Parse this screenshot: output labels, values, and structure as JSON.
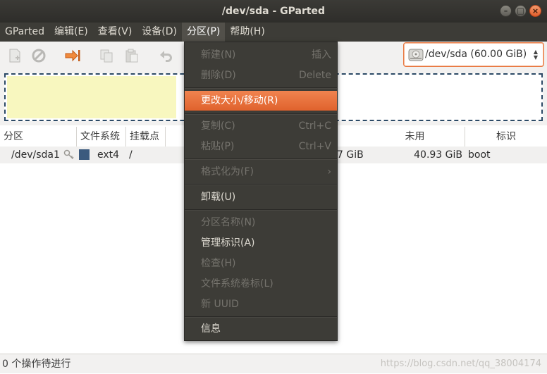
{
  "window": {
    "title": "/dev/sda - GParted"
  },
  "menubar": {
    "items": [
      {
        "label": "GParted"
      },
      {
        "label": "编辑(E)"
      },
      {
        "label": "查看(V)"
      },
      {
        "label": "设备(D)"
      },
      {
        "label": "分区(P)"
      },
      {
        "label": "帮助(H)"
      }
    ]
  },
  "toolbar": {
    "icons": [
      "new-icon",
      "delete-icon",
      "resize-move-icon",
      "copy-icon",
      "paste-icon",
      "undo-icon"
    ]
  },
  "device_selector": {
    "label": "/dev/sda   (60.00 GiB)"
  },
  "table": {
    "headers": [
      "分区",
      "文件系统",
      "挂载点",
      "未用",
      "标识"
    ],
    "row": {
      "partition": "/dev/sda1",
      "filesystem": "ext4",
      "mountpoint": "/",
      "size_partial": "7 GiB",
      "unused": "40.93 GiB",
      "flags": "boot"
    },
    "fs_color": "#3b5a7e"
  },
  "partition_menu": {
    "items": [
      {
        "label": "新建(N)",
        "accel": "插入",
        "disabled": true
      },
      {
        "label": "删除(D)",
        "accel": "Delete",
        "disabled": true
      },
      {
        "label": "更改大小/移动(R)",
        "accel": "",
        "disabled": false,
        "highlighted": true
      },
      {
        "label": "复制(C)",
        "accel": "Ctrl+C",
        "disabled": true
      },
      {
        "label": "粘贴(P)",
        "accel": "Ctrl+V",
        "disabled": true
      },
      {
        "label": "格式化为(F)",
        "accel": "›",
        "disabled": true
      },
      {
        "label": "卸载(U)",
        "accel": "",
        "disabled": false
      },
      {
        "label": "分区名称(N)",
        "accel": "",
        "disabled": true
      },
      {
        "label": "管理标识(A)",
        "accel": "",
        "disabled": false
      },
      {
        "label": "检查(H)",
        "accel": "",
        "disabled": true
      },
      {
        "label": "文件系统卷标(L)",
        "accel": "",
        "disabled": true
      },
      {
        "label": "新 UUID",
        "accel": "",
        "disabled": true
      },
      {
        "label": "信息",
        "accel": "",
        "disabled": false
      }
    ]
  },
  "statusbar": {
    "text": "0 个操作待进行"
  },
  "watermark": "https://blog.csdn.net/qq_38004174",
  "colors": {
    "accent": "#e95420",
    "menu_bg": "#3d3c37"
  }
}
